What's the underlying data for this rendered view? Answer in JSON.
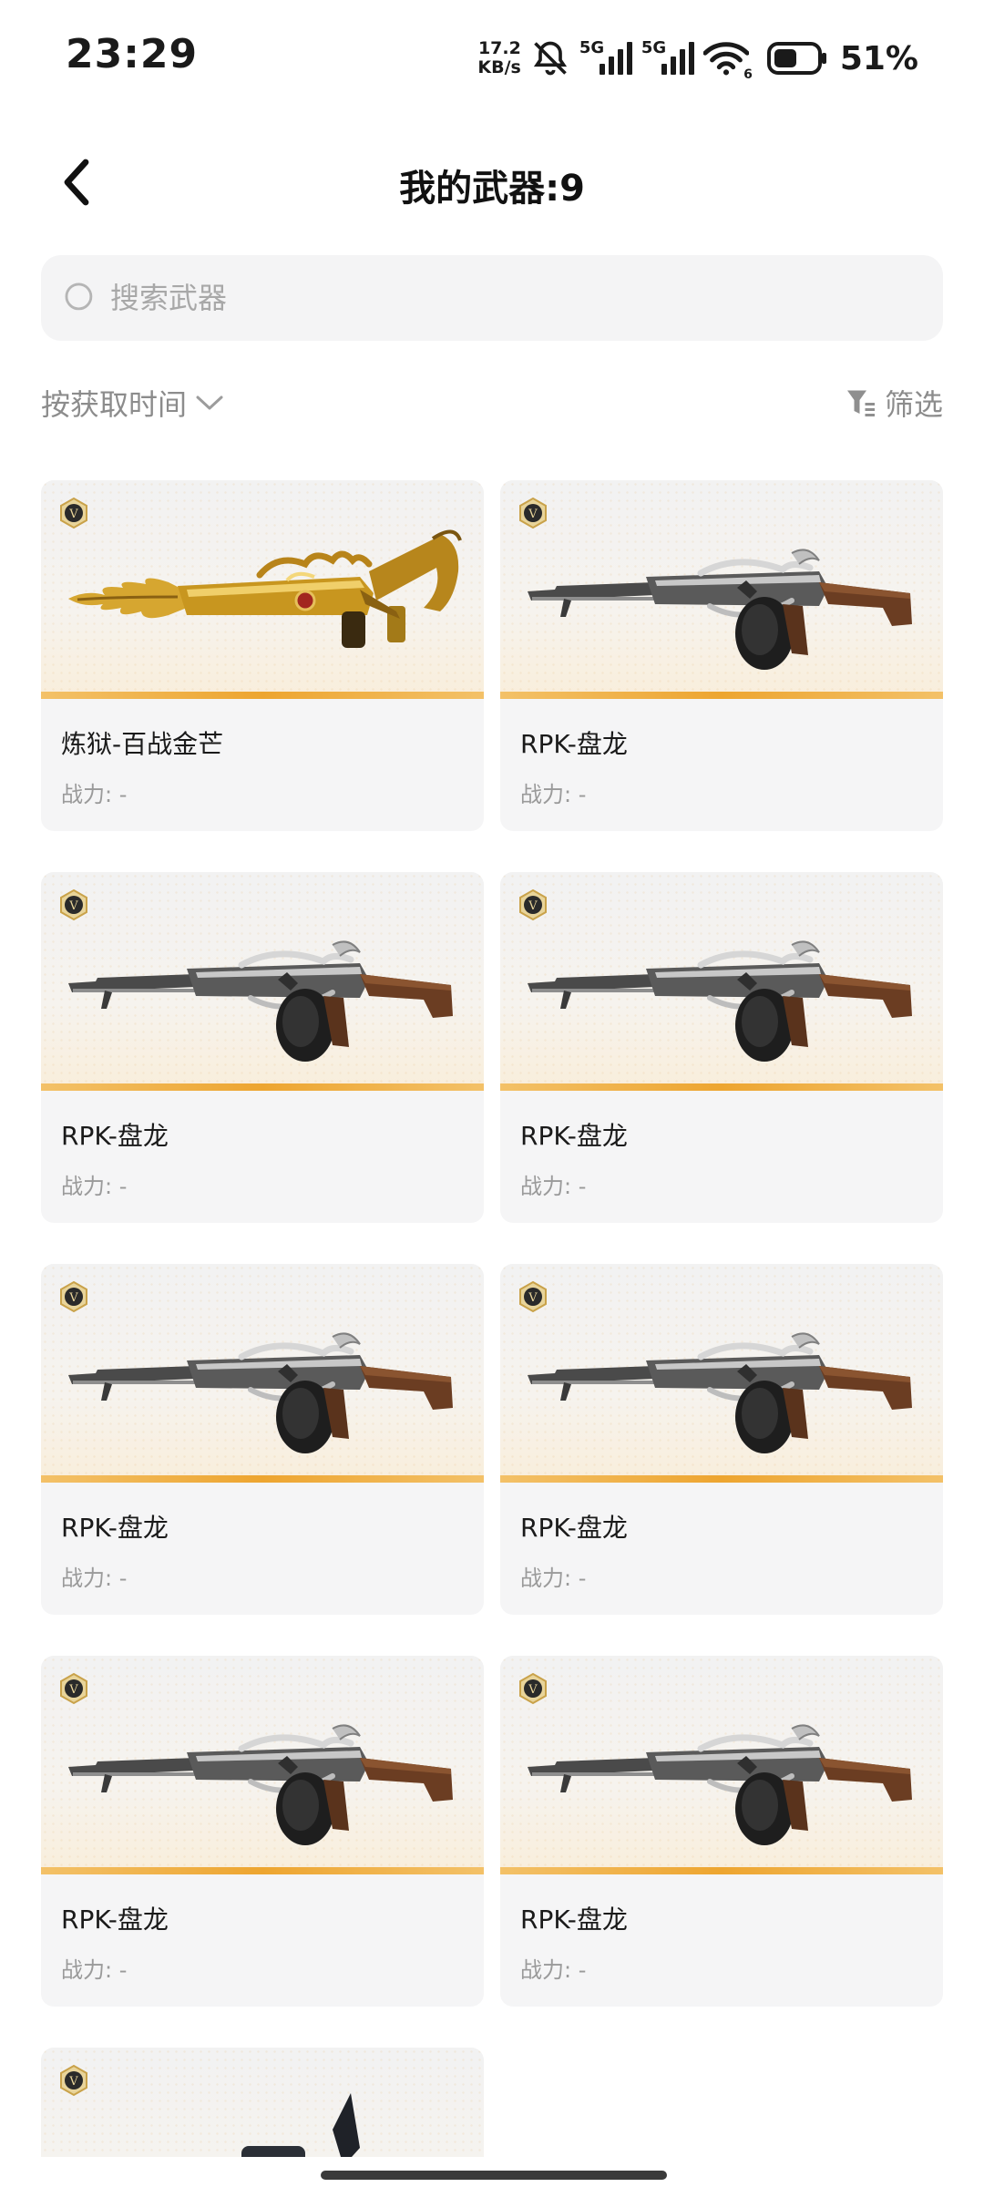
{
  "status_bar": {
    "time": "23:29",
    "net_speed_value": "17.2",
    "net_speed_unit": "KB/s",
    "sim1_label": "5G",
    "sim2_label": "5G",
    "wifi_badge": "6",
    "battery_percent": "51%"
  },
  "header": {
    "title": "我的武器:9"
  },
  "search": {
    "placeholder": "搜索武器",
    "value": ""
  },
  "toolbar": {
    "sort_label": "按获取时间",
    "filter_label": "筛选"
  },
  "weapons": [
    {
      "name": "炼狱-百战金芒",
      "power": "战力: -",
      "style": "gold",
      "badge": "V"
    },
    {
      "name": "RPK-盘龙",
      "power": "战力: -",
      "style": "rpk",
      "badge": "V"
    },
    {
      "name": "RPK-盘龙",
      "power": "战力: -",
      "style": "rpk",
      "badge": "V"
    },
    {
      "name": "RPK-盘龙",
      "power": "战力: -",
      "style": "rpk",
      "badge": "V"
    },
    {
      "name": "RPK-盘龙",
      "power": "战力: -",
      "style": "rpk",
      "badge": "V"
    },
    {
      "name": "RPK-盘龙",
      "power": "战力: -",
      "style": "rpk",
      "badge": "V"
    },
    {
      "name": "RPK-盘龙",
      "power": "战力: -",
      "style": "rpk",
      "badge": "V"
    },
    {
      "name": "RPK-盘龙",
      "power": "战力: -",
      "style": "rpk",
      "badge": "V"
    }
  ],
  "partial_weapon": {
    "style": "silver-dark",
    "badge": "V"
  },
  "colors": {
    "accent_stripe": "#eda530",
    "badge_gold": "#c9a24a",
    "card_bg": "#f5f5f6"
  }
}
